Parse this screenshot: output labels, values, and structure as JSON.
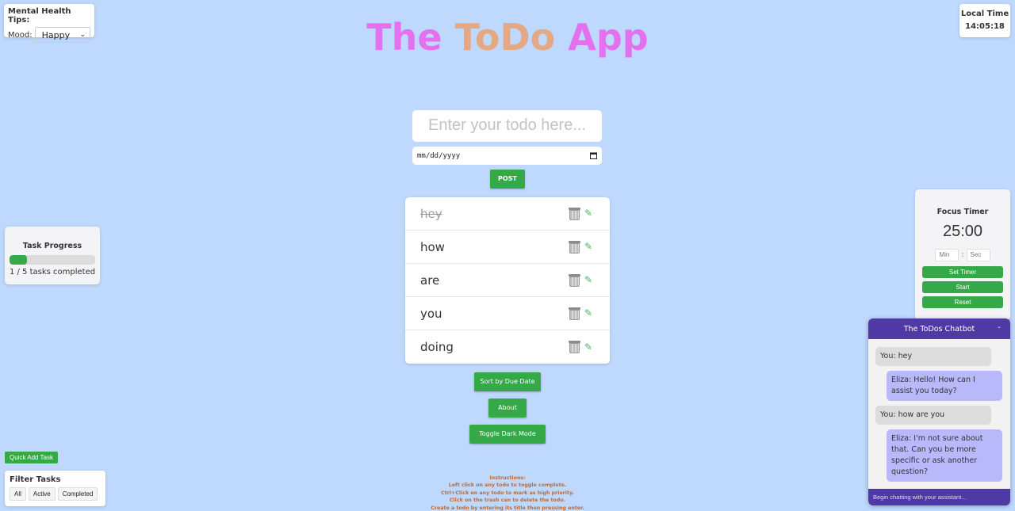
{
  "mood_widget": {
    "title": "Mental Health Tips:",
    "label": "Mood:",
    "selected": "Happy"
  },
  "title": {
    "part1": "The ",
    "part2": "ToDo",
    "part3": " App",
    "colors": {
      "pink": "#e371ef",
      "orange": "#e4a884"
    }
  },
  "clock": {
    "label": "Local Time",
    "time": "14:05:18"
  },
  "todo_form": {
    "input_placeholder": "Enter your todo here...",
    "date_placeholder": "mm/dd/yyyy",
    "post_label": "POST"
  },
  "todos": [
    {
      "text": "hey",
      "completed": true
    },
    {
      "text": "how",
      "completed": false
    },
    {
      "text": "are",
      "completed": false
    },
    {
      "text": "you",
      "completed": false
    },
    {
      "text": "doing",
      "completed": false
    }
  ],
  "actions": {
    "sort_label": "Sort by Due Date",
    "about_label": "About",
    "dark_mode_label": "Toggle Dark Mode"
  },
  "instructions": [
    "Instructions:",
    "Left click on any todo to toggle complete.",
    "Ctrl+Click on any todo to mark as high priority.",
    "Click on the trash can to delete the todo.",
    "Create a todo by entering its title then pressing enter."
  ],
  "progress": {
    "title": "Task Progress",
    "completed": 1,
    "total": 5,
    "fraction": 0.2,
    "label": "1 / 5 tasks completed"
  },
  "quick_add_label": "Quick Add Task",
  "filter": {
    "title": "Filter Tasks",
    "options": [
      "All",
      "Active",
      "Completed"
    ]
  },
  "timer": {
    "title": "Focus Timer",
    "display": "25:00",
    "min_placeholder": "Min",
    "sec_placeholder": "Sec",
    "separator": ":",
    "set_label": "Set Timer",
    "start_label": "Start",
    "reset_label": "Reset"
  },
  "chatbot": {
    "title": "The ToDos Chatbot",
    "minimize_label": "-",
    "messages": [
      {
        "sender": "user",
        "text": "You: hey"
      },
      {
        "sender": "bot",
        "text": "Eliza: Hello! How can I assist you today?"
      },
      {
        "sender": "user",
        "text": "You: how are you"
      },
      {
        "sender": "bot",
        "text": "Eliza: I'm not sure about that. Can you be more specific or ask another question?"
      }
    ],
    "input_placeholder": "Begin chatting with your assistant..."
  },
  "colors": {
    "background": "#bed9fd",
    "accent_green": "#35a847",
    "chat_purple": "#4f3aa5",
    "bot_bubble": "#b8b8fb",
    "instruction_text": "#b86b3c"
  }
}
